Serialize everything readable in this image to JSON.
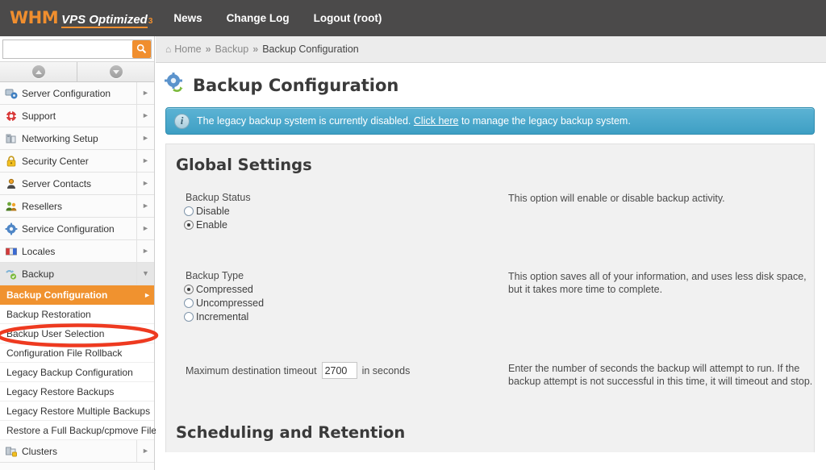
{
  "brand": {
    "name": "WHM",
    "edition": "VPS Optimized",
    "sup": "3"
  },
  "topnav": [
    {
      "label": "News"
    },
    {
      "label": "Change Log"
    },
    {
      "label": "Logout (root)"
    }
  ],
  "search": {
    "value": "",
    "placeholder": "",
    "icon": "search-icon"
  },
  "sidebar": {
    "collapse_all_icon": "chevron-up-icon",
    "expand_all_icon": "chevron-down-icon",
    "groups": [
      {
        "label": "Server Configuration",
        "icon": "server-configuration-icon",
        "arrow": "►",
        "open": false
      },
      {
        "label": "Support",
        "icon": "support-lifering-icon",
        "arrow": "►",
        "open": false
      },
      {
        "label": "Networking Setup",
        "icon": "networking-setup-icon",
        "arrow": "►",
        "open": false
      },
      {
        "label": "Security Center",
        "icon": "padlock-icon",
        "arrow": "►",
        "open": false
      },
      {
        "label": "Server Contacts",
        "icon": "server-contacts-icon",
        "arrow": "►",
        "open": false
      },
      {
        "label": "Resellers",
        "icon": "resellers-icon",
        "arrow": "►",
        "open": false
      },
      {
        "label": "Service Configuration",
        "icon": "gear-icon",
        "arrow": "►",
        "open": false
      },
      {
        "label": "Locales",
        "icon": "locales-flag-icon",
        "arrow": "►",
        "open": false
      },
      {
        "label": "Backup",
        "icon": "backup-icon",
        "arrow": "▼",
        "open": true
      }
    ],
    "backup_items": [
      {
        "label": "Backup Configuration",
        "active": true,
        "arrow": "►"
      },
      {
        "label": "Backup Restoration",
        "active": false
      },
      {
        "label": "Backup User Selection",
        "active": false
      },
      {
        "label": "Configuration File Rollback",
        "active": false
      },
      {
        "label": "Legacy Backup Configuration",
        "active": false
      },
      {
        "label": "Legacy Restore Backups",
        "active": false
      },
      {
        "label": "Legacy Restore Multiple Backups",
        "active": false
      },
      {
        "label": "Restore a Full Backup/cpmove File",
        "active": false
      }
    ],
    "clusters": {
      "label": "Clusters",
      "icon": "clusters-icon",
      "arrow": "►"
    },
    "annotation": {
      "shape": "ellipse-highlight",
      "color": "#ee3a20",
      "target": "Backup Configuration"
    }
  },
  "breadcrumb": {
    "home_icon": "home-icon",
    "items": [
      "Home",
      "Backup",
      "Backup Configuration"
    ],
    "separator": "»"
  },
  "page": {
    "title": "Backup Configuration",
    "icon": "backup-configuration-icon"
  },
  "notice": {
    "icon": "info-icon",
    "text_before": "The legacy backup system is currently disabled.",
    "link": "Click here",
    "text_after": "to manage the legacy backup system.",
    "color": "#3e9fc4"
  },
  "global_settings": {
    "heading": "Global Settings",
    "backup_status": {
      "label": "Backup Status",
      "help": "This option will enable or disable backup activity.",
      "options": [
        {
          "label": "Disable",
          "selected": false
        },
        {
          "label": "Enable",
          "selected": true
        }
      ]
    },
    "backup_type": {
      "label": "Backup Type",
      "help": "This option saves all of your information, and uses less disk space, but it takes more time to complete.",
      "options": [
        {
          "label": "Compressed",
          "selected": true
        },
        {
          "label": "Uncompressed",
          "selected": false
        },
        {
          "label": "Incremental",
          "selected": false
        }
      ]
    },
    "timeout": {
      "label_before": "Maximum destination timeout",
      "value": "2700",
      "label_after": "in seconds",
      "help": "Enter the number of seconds the backup will attempt to run. If the backup attempt is not successful in this time, it will timeout and stop."
    }
  },
  "scheduling": {
    "heading": "Scheduling and Retention"
  }
}
